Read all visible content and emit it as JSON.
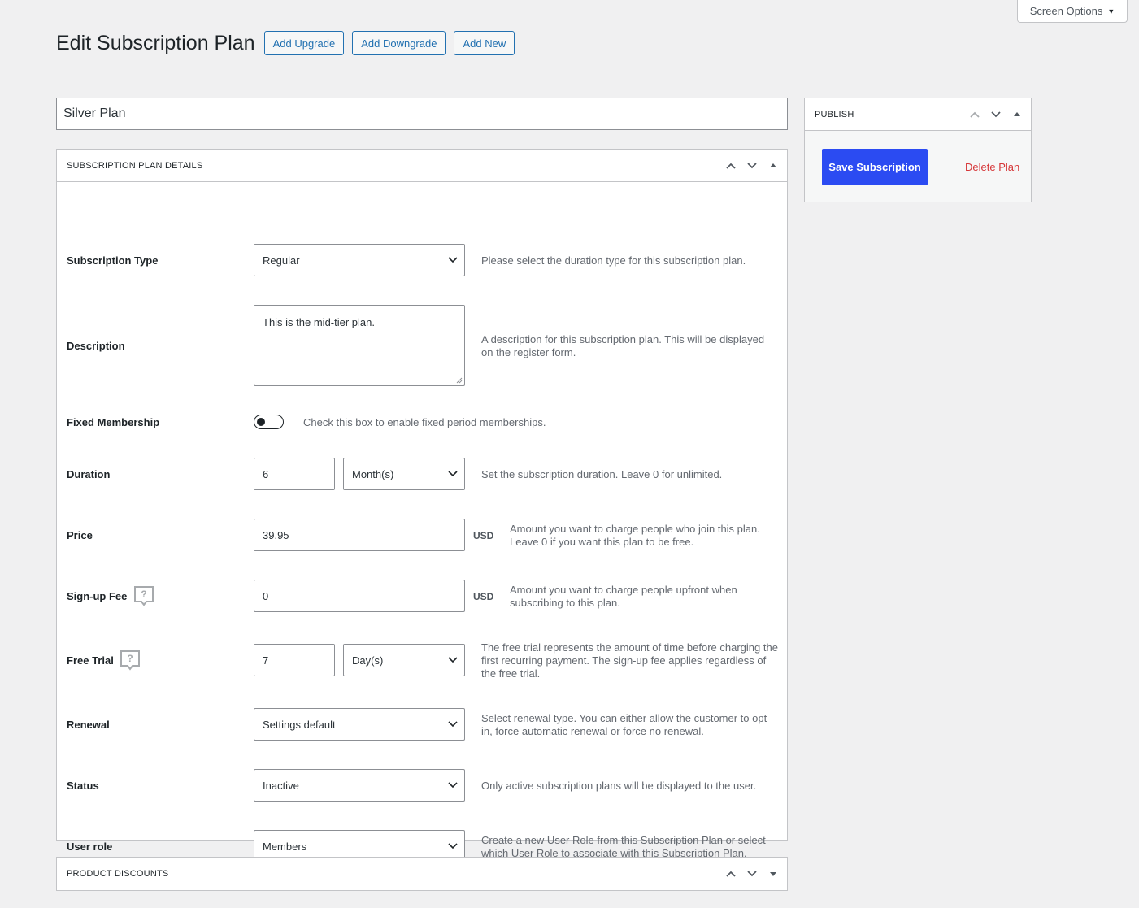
{
  "screen_options": {
    "label": "Screen Options"
  },
  "header": {
    "title": "Edit Subscription Plan",
    "buttons": [
      "Add Upgrade",
      "Add Downgrade",
      "Add New"
    ]
  },
  "title_field": {
    "value": "Silver Plan"
  },
  "details_box": {
    "title": "SUBSCRIPTION PLAN DETAILS",
    "rows": {
      "subscription_type": {
        "label": "Subscription Type",
        "value": "Regular",
        "desc": "Please select the duration type for this subscription plan."
      },
      "description": {
        "label": "Description",
        "value": "This is the mid-tier plan.",
        "desc": "A description for this subscription plan. This will be displayed on the register form."
      },
      "fixed_membership": {
        "label": "Fixed Membership",
        "checked": false,
        "desc": "Check this box to enable fixed period memberships."
      },
      "duration": {
        "label": "Duration",
        "value": "6",
        "unit": "Month(s)",
        "desc": "Set the subscription duration. Leave 0 for unlimited."
      },
      "price": {
        "label": "Price",
        "value": "39.95",
        "currency": "USD",
        "desc": "Amount you want to charge people who join this plan. Leave 0 if you want this plan to be free."
      },
      "signup_fee": {
        "label": "Sign-up Fee",
        "value": "0",
        "currency": "USD",
        "desc": "Amount you want to charge people upfront when subscribing to this plan."
      },
      "free_trial": {
        "label": "Free Trial",
        "value": "7",
        "unit": "Day(s)",
        "desc": "The free trial represents the amount of time before charging the first recurring payment. The sign-up fee applies regardless of the free trial."
      },
      "renewal": {
        "label": "Renewal",
        "value": "Settings default",
        "desc": "Select renewal type. You can either allow the customer to opt in, force automatic renewal or force no renewal."
      },
      "status": {
        "label": "Status",
        "value": "Inactive",
        "desc": "Only active subscription plans will be displayed to the user."
      },
      "user_role": {
        "label": "User role",
        "value": "Members",
        "desc": "Create a new User Role from this Subscription Plan or select which User Role to associate with this Subscription Plan."
      }
    }
  },
  "discounts_box": {
    "title": "PRODUCT DISCOUNTS"
  },
  "publish_box": {
    "title": "PUBLISH",
    "save_label": "Save Subscription",
    "delete_label": "Delete Plan"
  },
  "colors": {
    "primary_button": "#2b4bf2",
    "delete_link": "#d63638",
    "link": "#2271b1"
  },
  "icons": [
    "triangle-down-icon",
    "chevron-up-icon",
    "chevron-down-icon",
    "triangle-up-icon",
    "help-bubble-icon"
  ]
}
